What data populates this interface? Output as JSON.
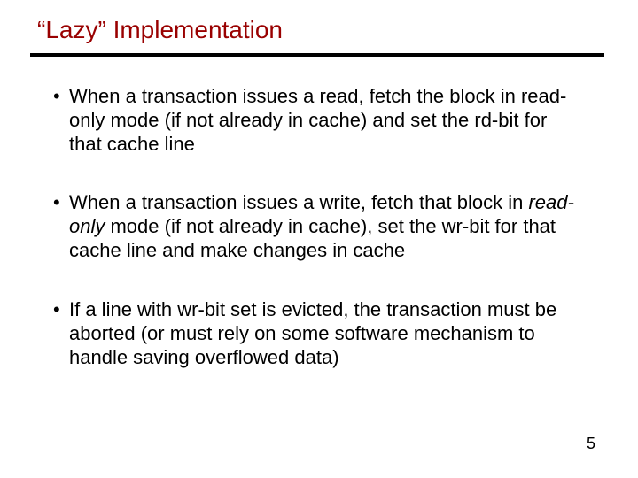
{
  "title": "“Lazy” Implementation",
  "bullets": {
    "b1": "When a transaction issues a read, fetch the block in read-only mode (if not already in cache) and set the rd-bit for that cache line",
    "b2_pre": "When a transaction issues a write, fetch that block in ",
    "b2_em": "read-only",
    "b2_post": " mode (if not already in cache), set the wr-bit for that cache line and make changes in cache",
    "b3": "If a line with wr-bit set is evicted, the transaction must be aborted (or must rely on some software mechanism to handle saving overflowed data)"
  },
  "page_number": "5"
}
